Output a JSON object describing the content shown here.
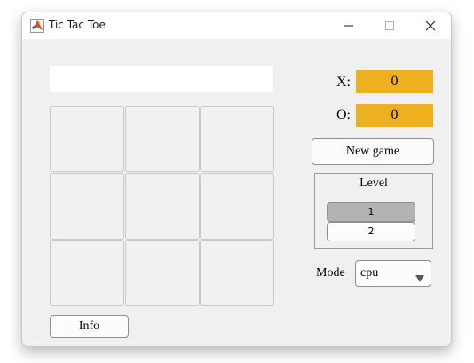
{
  "window": {
    "title": "Tic Tac Toe",
    "title_icon": "matlab-icon"
  },
  "status": {
    "value": ""
  },
  "board": {
    "cells": [
      "",
      "",
      "",
      "",
      "",
      "",
      "",
      "",
      ""
    ]
  },
  "score": {
    "x_label": "X:",
    "x_value": "0",
    "o_label": "O:",
    "o_value": "0",
    "highlight_color": "#edb120"
  },
  "buttons": {
    "new_game": "New game",
    "info": "Info"
  },
  "level": {
    "title": "Level",
    "options": [
      "1",
      "2"
    ],
    "selected": "1"
  },
  "mode": {
    "label": "Mode",
    "value": "cpu"
  }
}
